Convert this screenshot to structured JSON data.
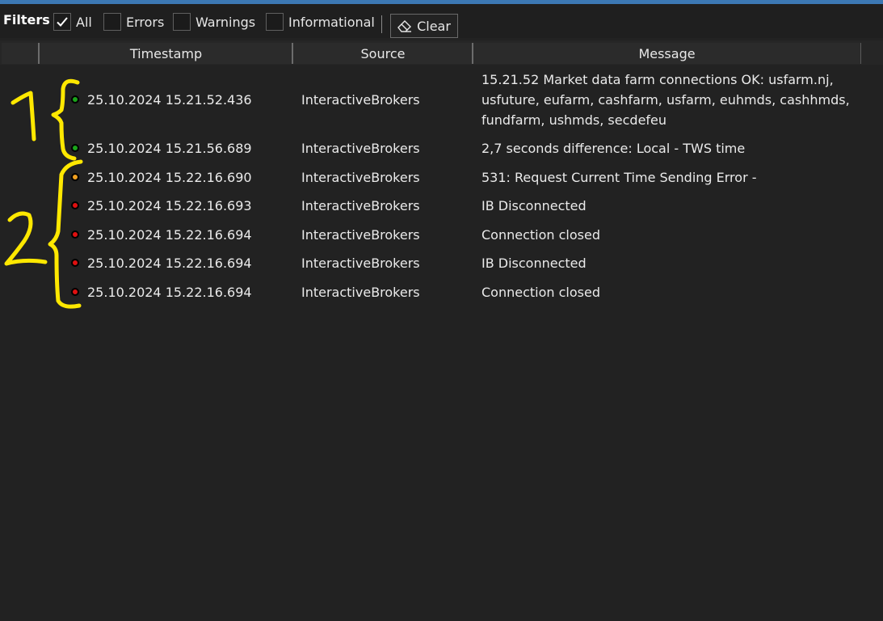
{
  "filters": {
    "label": "Filters",
    "options": [
      {
        "label": "All",
        "checked": true
      },
      {
        "label": "Errors",
        "checked": false
      },
      {
        "label": "Warnings",
        "checked": false
      },
      {
        "label": "Informational",
        "checked": false
      }
    ],
    "clear_label": "Clear"
  },
  "columns": [
    "Timestamp",
    "Source",
    "Message"
  ],
  "rows": [
    {
      "level": "info",
      "timestamp": "25.10.2024 15.21.52.436",
      "source": "InteractiveBrokers",
      "message": "15.21.52 Market data farm connections OK: usfarm.nj, usfuture, eufarm, cashfarm, usfarm, euhmds, cashhmds, fundfarm, ushmds, secdefeu"
    },
    {
      "level": "info",
      "timestamp": "25.10.2024 15.21.56.689",
      "source": "InteractiveBrokers",
      "message": "2,7 seconds difference: Local - TWS time"
    },
    {
      "level": "warning",
      "timestamp": "25.10.2024 15.22.16.690",
      "source": "InteractiveBrokers",
      "message": "531: Request Current Time Sending Error -"
    },
    {
      "level": "error",
      "timestamp": "25.10.2024 15.22.16.693",
      "source": "InteractiveBrokers",
      "message": "IB Disconnected"
    },
    {
      "level": "error",
      "timestamp": "25.10.2024 15.22.16.694",
      "source": "InteractiveBrokers",
      "message": "Connection closed"
    },
    {
      "level": "error",
      "timestamp": "25.10.2024 15.22.16.694",
      "source": "InteractiveBrokers",
      "message": "IB Disconnected"
    },
    {
      "level": "error",
      "timestamp": "25.10.2024 15.22.16.694",
      "source": "InteractiveBrokers",
      "message": "Connection closed"
    }
  ],
  "colors": {
    "accent": "#3c78b4",
    "info": "#1aa51a",
    "warning": "#f0a020",
    "error": "#e01010",
    "annotation": "#ffe800"
  },
  "icons": {
    "checkmark": "checkmark-icon",
    "clear": "eraser-icon",
    "info": "green-status-dot-icon",
    "warning": "orange-status-dot-icon",
    "error": "red-status-dot-icon"
  },
  "annotations": [
    "1",
    "2"
  ]
}
